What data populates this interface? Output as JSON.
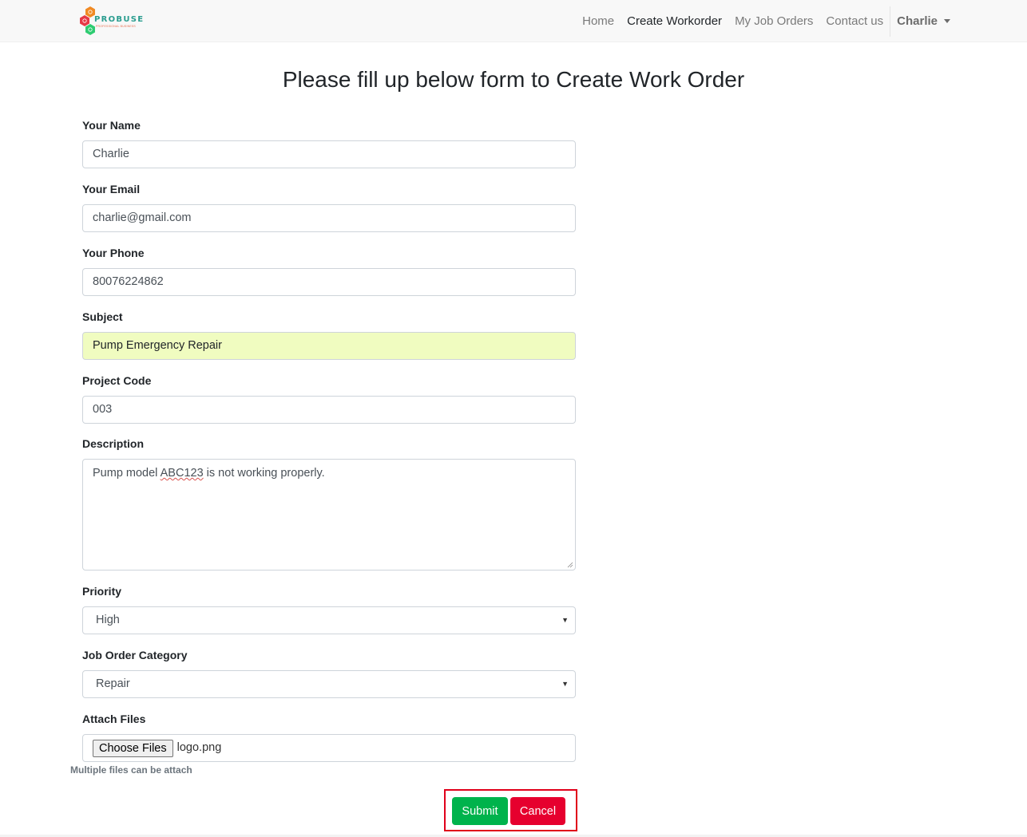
{
  "brand": {
    "name": "PROBUSE",
    "tagline": "PROFESSIONAL BUSINESS",
    "colors": {
      "orange": "#f08a24",
      "red": "#e63946",
      "green": "#2ecc71",
      "teal": "#2a9d8f"
    }
  },
  "nav": {
    "items": [
      {
        "label": "Home"
      },
      {
        "label": "Create Workorder"
      },
      {
        "label": "My Job Orders"
      },
      {
        "label": "Contact us"
      }
    ],
    "user": "Charlie"
  },
  "page": {
    "title": "Please fill up below form to Create Work Order"
  },
  "form": {
    "name": {
      "label": "Your Name",
      "value": "Charlie"
    },
    "email": {
      "label": "Your Email",
      "value": "charlie@gmail.com"
    },
    "phone": {
      "label": "Your Phone",
      "value": "80076224862"
    },
    "subject": {
      "label": "Subject",
      "value": "Pump Emergency Repair"
    },
    "project_code": {
      "label": "Project Code",
      "value": "003"
    },
    "description": {
      "label": "Description",
      "value_before": "Pump model ",
      "value_flagged": "ABC123",
      "value_after": " is not working properly."
    },
    "priority": {
      "label": "Priority",
      "selected": "High"
    },
    "category": {
      "label": "Job Order Category",
      "selected": "Repair"
    },
    "attach": {
      "label": "Attach Files",
      "button": "Choose Files",
      "file_name": "logo.png",
      "help": "Multiple files can be attach"
    }
  },
  "actions": {
    "submit": "Submit",
    "cancel": "Cancel"
  },
  "colors": {
    "submit": "#00b34c",
    "cancel": "#e6002e",
    "highlight_border": "#e0001a",
    "autofill": "#f0fcc0"
  }
}
